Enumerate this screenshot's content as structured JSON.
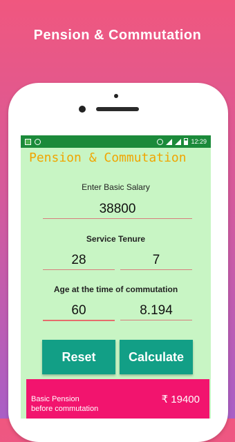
{
  "promo": {
    "title": "Pension & Commutation"
  },
  "status_bar": {
    "time": "12:29"
  },
  "app": {
    "title": "Pension & Commutation",
    "basic_salary": {
      "label": "Enter Basic Salary",
      "value": "38800"
    },
    "service_tenure": {
      "label": "Service Tenure",
      "years": "28",
      "months": "7"
    },
    "age": {
      "label": "Age at the time of commutation",
      "age": "60",
      "factor": "8.194"
    },
    "buttons": {
      "reset": "Reset",
      "calculate": "Calculate"
    },
    "result": {
      "label_line1": "Basic Pension",
      "label_line2": "before commutation",
      "value": "₹ 19400"
    }
  },
  "colors": {
    "accent_title": "#f0a500",
    "button": "#129f86",
    "result_card": "#f2146e",
    "screen_bg": "#c8f5c4",
    "status_bar": "#1b8a3a"
  }
}
